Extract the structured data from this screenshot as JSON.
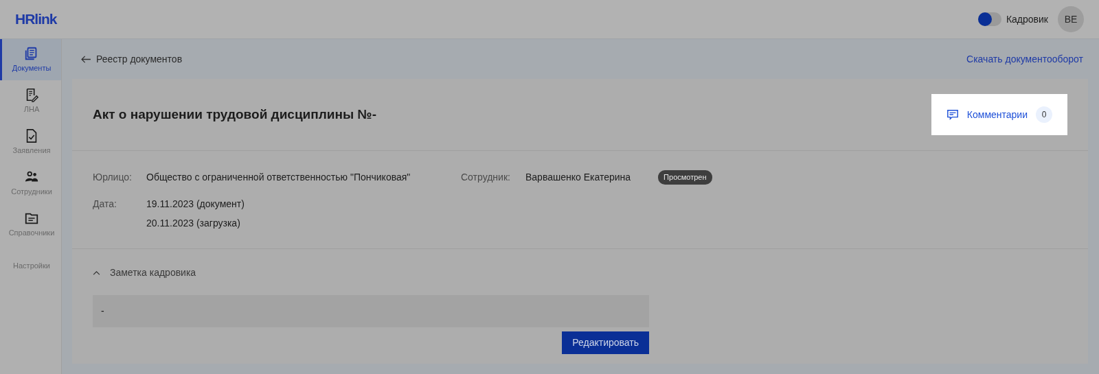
{
  "header": {
    "logo": "HRlink",
    "role_switch": {
      "label": "Кадровик",
      "on": false
    },
    "avatar": "BE"
  },
  "sidebar": {
    "items": [
      {
        "label": "Документы",
        "selected": true
      },
      {
        "label": "ЛНА",
        "selected": false
      },
      {
        "label": "Заявления",
        "selected": false
      },
      {
        "label": "Сотрудники",
        "selected": false
      },
      {
        "label": "Справочники",
        "selected": false
      },
      {
        "label": "Настройки",
        "selected": false
      }
    ]
  },
  "breadcrumb": {
    "back": "Реестр документов",
    "download": "Скачать документооборот"
  },
  "document": {
    "title": "Акт о нарушении трудовой дисциплины №-",
    "comments": {
      "label": "Комментарии",
      "count": "0"
    },
    "fields": [
      {
        "label": "Юрлицо:",
        "values": [
          "Общество с ограниченной ответственностью \"Пончиковая\""
        ]
      },
      {
        "label": "Сотрудник:",
        "values": [
          "Варвашенко Екатерина"
        ],
        "badge": "Просмотрен"
      },
      {
        "label": "Дата:",
        "values": [
          "19.11.2023 (документ)",
          "20.11.2023 (загрузка)"
        ]
      }
    ],
    "note": {
      "title": "Заметка кадровика",
      "expanded": true,
      "value": "-",
      "button": "Редактировать"
    }
  }
}
